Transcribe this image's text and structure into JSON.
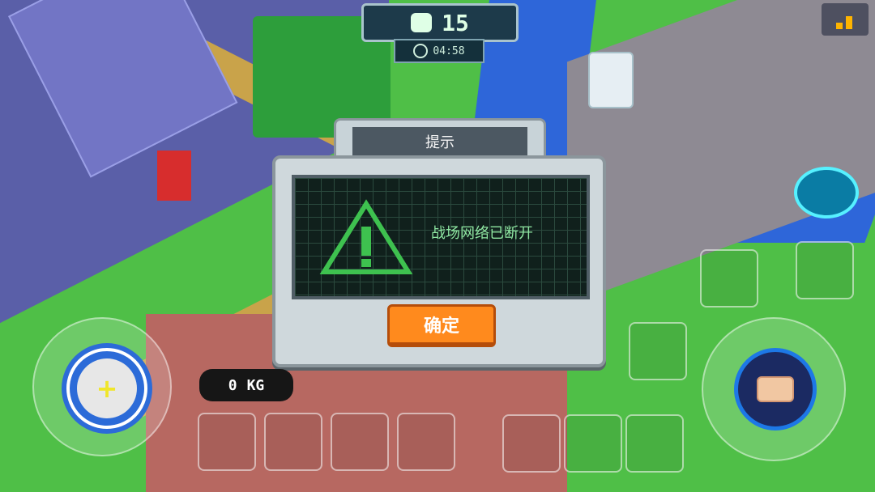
{
  "hud": {
    "player_count": "15",
    "player_icon": "skull-icon",
    "timer": "04:58",
    "timer_icon": "biohazard-icon",
    "signal_icon": "signal-icon"
  },
  "dialog": {
    "title": "提示",
    "message": "战场网络已断开",
    "icon": "warning-icon",
    "ok_label": "确定"
  },
  "inventory": {
    "weight_value": "0",
    "weight_unit": "KG",
    "slots": [
      "slot-1",
      "slot-2",
      "slot-3",
      "slot-4",
      "slot-5"
    ]
  },
  "controls": {
    "add_button_icon": "plus-icon",
    "action_button_icon": "hand-icon",
    "side_button_icon": "armor-icon",
    "quick_slots": [
      "quick-slot-1",
      "quick-slot-2",
      "quick-slot-3",
      "quick-slot-4",
      "quick-slot-5",
      "quick-slot-6"
    ]
  },
  "colors": {
    "accent_orange": "#ff8a1d",
    "screen_green": "#8fe7a2",
    "hud_teal": "#1d3a4a"
  }
}
